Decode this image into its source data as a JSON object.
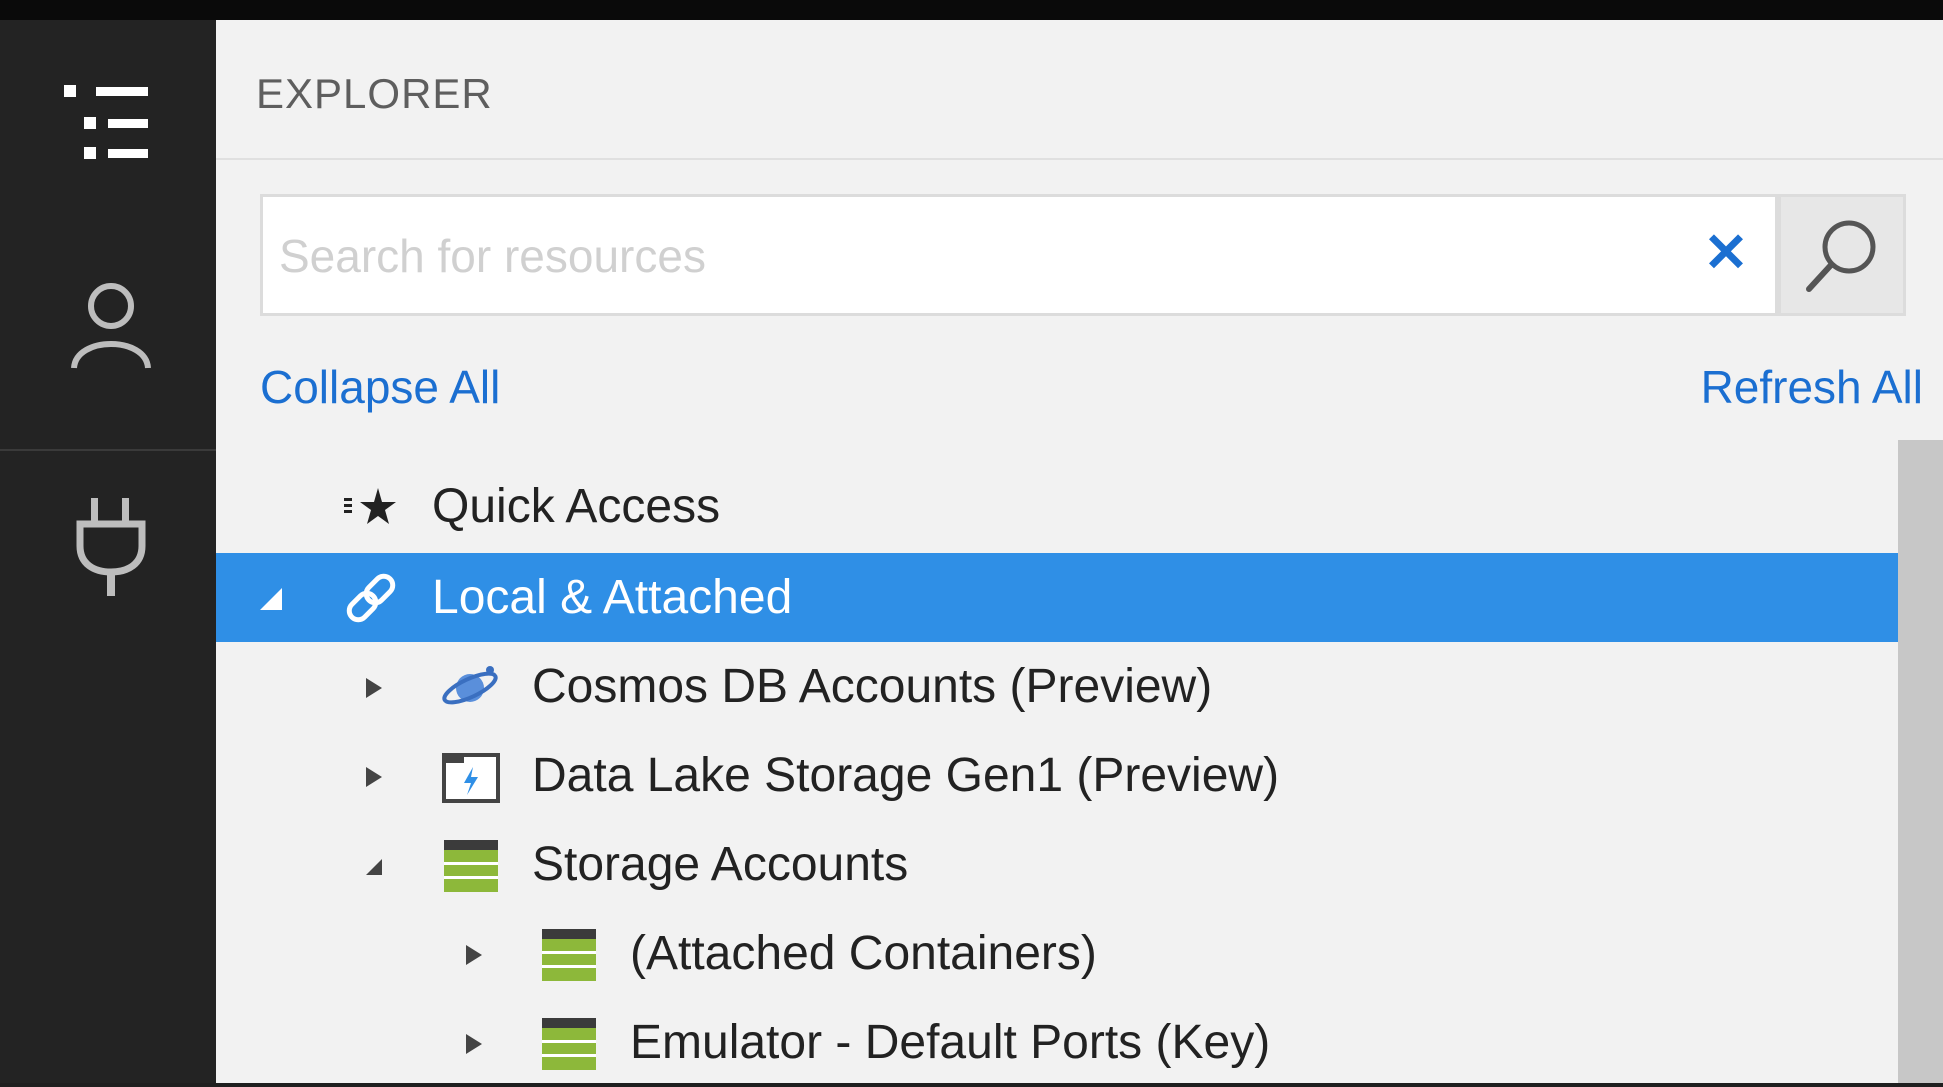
{
  "activity_bar": {
    "items": [
      {
        "name": "explorer-icon",
        "active": true
      },
      {
        "name": "account-icon",
        "active": false
      },
      {
        "name": "connect-plug-icon",
        "active": false
      }
    ]
  },
  "explorer": {
    "title": "EXPLORER",
    "search": {
      "placeholder": "Search for resources",
      "value": "",
      "clear_glyph": "✕"
    },
    "actions": {
      "collapse_all": "Collapse All",
      "refresh_all": "Refresh All"
    },
    "tree": [
      {
        "label": "Quick Access",
        "icon": "quick-access-icon",
        "expander": "none",
        "selected": false
      },
      {
        "label": "Local & Attached",
        "icon": "link-icon",
        "expander": "expanded",
        "selected": true
      },
      {
        "label": "Cosmos DB Accounts (Preview)",
        "icon": "cosmos-db-icon",
        "expander": "collapsed",
        "selected": false
      },
      {
        "label": "Data Lake Storage Gen1 (Preview)",
        "icon": "data-lake-icon",
        "expander": "collapsed",
        "selected": false
      },
      {
        "label": "Storage Accounts",
        "icon": "storage-account-icon",
        "expander": "expanded",
        "selected": false
      },
      {
        "label": "(Attached Containers)",
        "icon": "storage-account-icon",
        "expander": "collapsed",
        "selected": false
      },
      {
        "label": "Emulator - Default Ports (Key)",
        "icon": "storage-account-icon",
        "expander": "collapsed",
        "selected": false
      }
    ]
  },
  "colors": {
    "accent": "#1b6fd1",
    "selection": "#2f8fe6",
    "activity_bar": "#232323",
    "panel": "#f2f2f2",
    "storage_green": "#8db83a"
  }
}
